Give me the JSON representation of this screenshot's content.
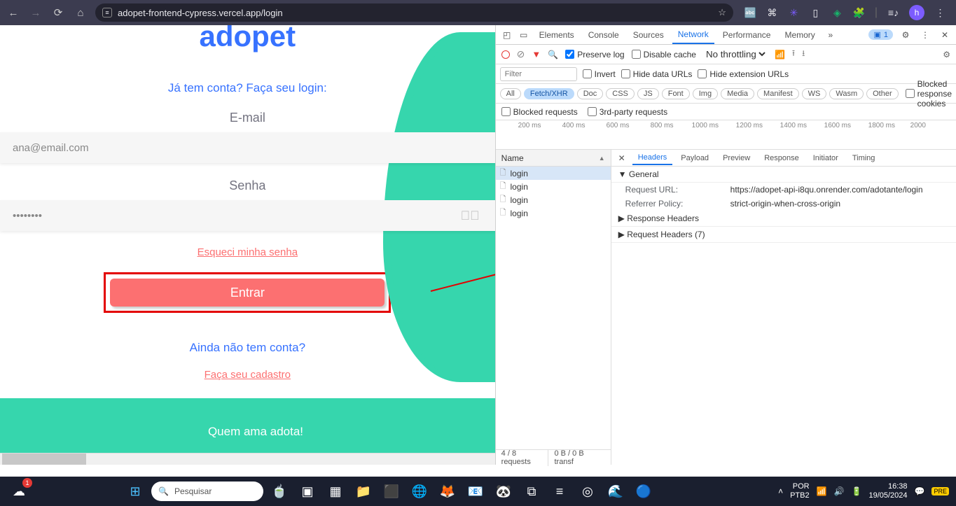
{
  "browser": {
    "url": "adopet-frontend-cypress.vercel.app/login",
    "avatar_letter": "h"
  },
  "page": {
    "logo": "adopet",
    "subtitle": "Já tem conta? Faça seu login:",
    "email_label": "E-mail",
    "email_value": "ana@email.com",
    "password_label": "Senha",
    "password_value": "••••••••",
    "forgot": "Esqueci minha senha",
    "login_button": "Entrar",
    "no_account": "Ainda não tem conta?",
    "signup": "Faça seu cadastro",
    "footer": "Quem ama adota!"
  },
  "devtools": {
    "tabs": [
      "Elements",
      "Console",
      "Sources",
      "Network",
      "Performance",
      "Memory"
    ],
    "active_tab": "Network",
    "issues_count": "1",
    "preserve_log": "Preserve log",
    "disable_cache": "Disable cache",
    "throttling": "No throttling",
    "filter_placeholder": "Filter",
    "invert": "Invert",
    "hide_data_urls": "Hide data URLs",
    "hide_ext_urls": "Hide extension URLs",
    "types": [
      "All",
      "Fetch/XHR",
      "Doc",
      "CSS",
      "JS",
      "Font",
      "Img",
      "Media",
      "Manifest",
      "WS",
      "Wasm",
      "Other"
    ],
    "active_type": "Fetch/XHR",
    "blocked_cookies": "Blocked response cookies",
    "blocked_requests": "Blocked requests",
    "third_party": "3rd-party requests",
    "timeline_ticks": [
      "200 ms",
      "400 ms",
      "600 ms",
      "800 ms",
      "1000 ms",
      "1200 ms",
      "1400 ms",
      "1600 ms",
      "1800 ms",
      "2000"
    ],
    "req_header": "Name",
    "requests": [
      "login",
      "login",
      "login",
      "login"
    ],
    "detail_tabs": [
      "Headers",
      "Payload",
      "Preview",
      "Response",
      "Initiator",
      "Timing"
    ],
    "active_detail_tab": "Headers",
    "section_general": "General",
    "section_response": "Response Headers",
    "section_request": "Request Headers (7)",
    "kv_request_url_k": "Request URL:",
    "kv_request_url_v": "https://adopet-api-i8qu.onrender.com/adotante/login",
    "kv_referrer_k": "Referrer Policy:",
    "kv_referrer_v": "strict-origin-when-cross-origin",
    "status_requests": "4 / 8 requests",
    "status_transfer": "0 B / 0 B transf"
  },
  "taskbar": {
    "search_placeholder": "Pesquisar",
    "weather_badge": "1",
    "lang1": "POR",
    "lang2": "PTB2",
    "time": "16:38",
    "date": "19/05/2024"
  }
}
